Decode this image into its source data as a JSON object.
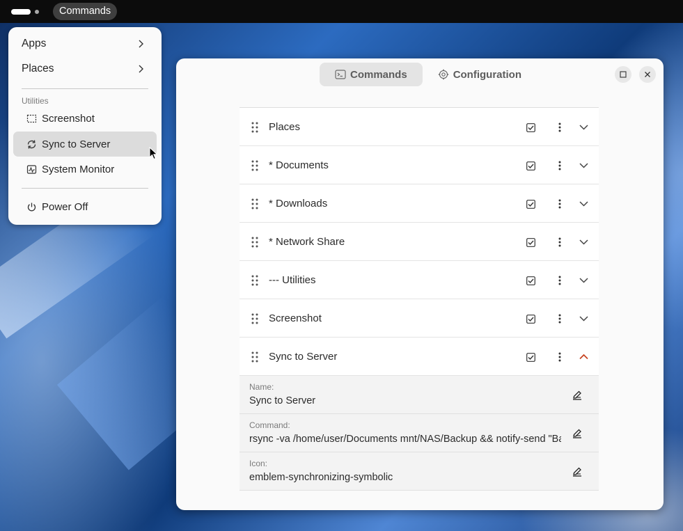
{
  "topbar": {
    "app_label": "Commands"
  },
  "menu": {
    "items": {
      "apps": "Apps",
      "places": "Places",
      "section_utilities": "Utilities",
      "screenshot": "Screenshot",
      "sync": "Sync to Server",
      "system_monitor": "System Monitor",
      "power_off": "Power Off"
    },
    "highlighted": "Sync to Server"
  },
  "window": {
    "tabs": [
      "Commands",
      "Configuration"
    ],
    "active_tab": "Commands",
    "rows": [
      {
        "label": "Places",
        "enabled": true
      },
      {
        "label": "* Documents",
        "enabled": true
      },
      {
        "label": "* Downloads",
        "enabled": true
      },
      {
        "label": "* Network Share",
        "enabled": true
      },
      {
        "label": "--- Utilities",
        "enabled": true
      },
      {
        "label": "Screenshot",
        "enabled": true
      },
      {
        "label": "Sync to Server",
        "enabled": true,
        "expanded": true
      }
    ],
    "details": {
      "name_label": "Name:",
      "name_value": "Sync to Server",
      "command_label": "Command:",
      "command_value": "rsync -va /home/user/Documents mnt/NAS/Backup && notify-send \"Backup Complete\"",
      "icon_label": "Icon:",
      "icon_value": "emblem-synchronizing-symbolic"
    }
  },
  "colors": {
    "accent_expanded_chevron": "#c7421f",
    "menu_highlight": "#dcdcdc",
    "topbar": "#0c0c0c"
  }
}
